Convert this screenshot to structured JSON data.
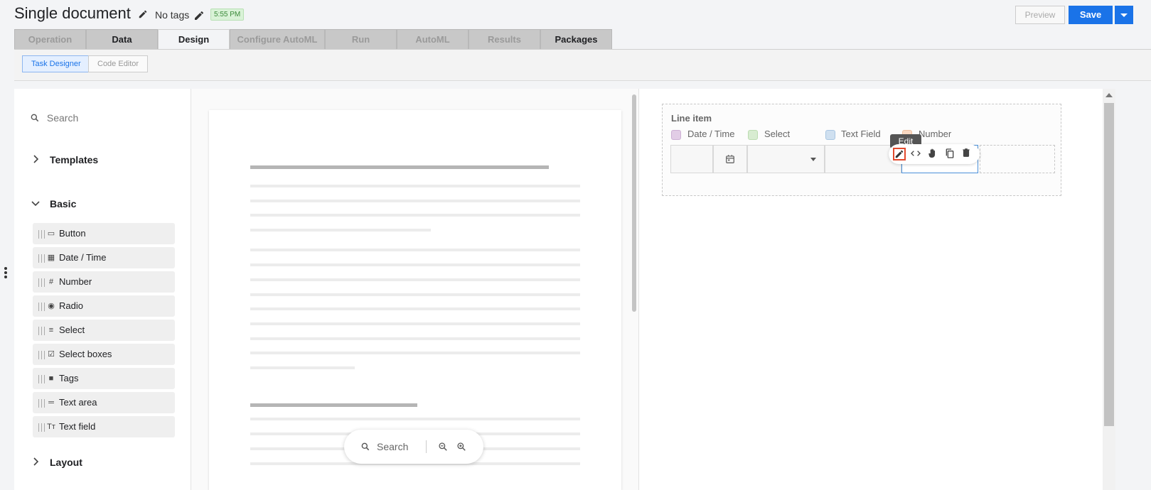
{
  "header": {
    "title": "Single document",
    "tags_label": "No tags",
    "time_badge": "5:55 PM"
  },
  "tabs": [
    {
      "label": "Operation",
      "state": "disabled"
    },
    {
      "label": "Data",
      "state": "enabled"
    },
    {
      "label": "Design",
      "state": "active"
    },
    {
      "label": "Configure AutoML",
      "state": "disabled"
    },
    {
      "label": "Run",
      "state": "disabled"
    },
    {
      "label": "AutoML",
      "state": "disabled"
    },
    {
      "label": "Results",
      "state": "disabled"
    },
    {
      "label": "Packages",
      "state": "enabled"
    }
  ],
  "toolbar": {
    "task_designer": "Task Designer",
    "code_editor": "Code Editor",
    "preview": "Preview",
    "save": "Save"
  },
  "palette": {
    "search_placeholder": "Search",
    "templates": "Templates",
    "basic": "Basic",
    "layout": "Layout",
    "items": [
      {
        "label": "Button",
        "icon": "button-icon"
      },
      {
        "label": "Date / Time",
        "icon": "calendar-icon"
      },
      {
        "label": "Number",
        "icon": "hash-icon"
      },
      {
        "label": "Radio",
        "icon": "radio-icon"
      },
      {
        "label": "Select",
        "icon": "select-icon"
      },
      {
        "label": "Select boxes",
        "icon": "checkbox-icon"
      },
      {
        "label": "Tags",
        "icon": "tag-icon"
      },
      {
        "label": "Text area",
        "icon": "text-area-icon"
      },
      {
        "label": "Text field",
        "icon": "text-field-icon"
      }
    ]
  },
  "doc_search": {
    "placeholder": "Search"
  },
  "designer": {
    "line_item_title": "Line item",
    "columns": [
      {
        "label": "Date / Time",
        "color": "#e2cde6"
      },
      {
        "label": "Select",
        "color": "#d8ecd1"
      },
      {
        "label": "Text Field",
        "color": "#cfe0f0"
      },
      {
        "label": "Number",
        "color": "#f8d8c2"
      }
    ],
    "tooltip": "Edit"
  },
  "colors": {
    "accent": "#1a73e8",
    "highlight": "#e24a2e"
  }
}
